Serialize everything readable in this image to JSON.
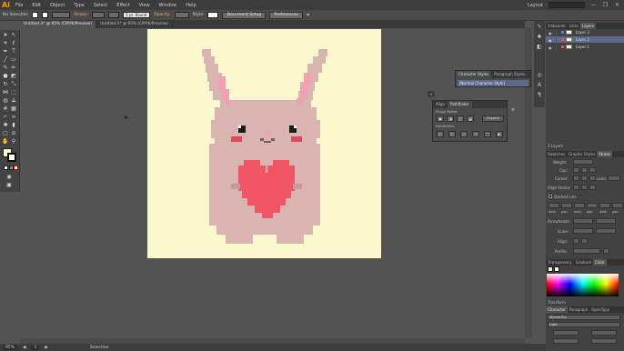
{
  "menubar": {
    "logo": "Ai",
    "items": [
      "File",
      "Edit",
      "Object",
      "Type",
      "Select",
      "Effect",
      "View",
      "Window",
      "Help"
    ],
    "workspace": "Layout",
    "controls": [
      "—",
      "❐",
      "✕"
    ]
  },
  "controlbar": {
    "selection_label": "No Selection",
    "stroke_label": "Stroke:",
    "brush_label": "5 pt. Round",
    "opacity_label": "Opacity:",
    "style_label": "Style:",
    "doc_setup_label": "Document Setup",
    "preferences_label": "Preferences"
  },
  "tabs": [
    {
      "label": "Untitled-1* @ 95% (CMYK/Preview)",
      "active": false
    },
    {
      "label": "Untitled-3* @ 95% (CMYK/Preview)",
      "active": true
    }
  ],
  "tool_icons": [
    "selection-icon",
    "direct-selection-icon",
    "magic-wand-icon",
    "lasso-icon",
    "pen-icon",
    "type-icon",
    "line-icon",
    "rectangle-icon",
    "paintbrush-icon",
    "pencil-icon",
    "blob-brush-icon",
    "eraser-icon",
    "rotate-icon",
    "scale-icon",
    "width-icon",
    "free-transform-icon",
    "shape-builder-icon",
    "perspective-icon",
    "mesh-icon",
    "gradient-icon",
    "eyedropper-icon",
    "blend-icon",
    "symbol-sprayer-icon",
    "graph-icon",
    "artboard-icon",
    "slice-icon",
    "hand-icon",
    "zoom-icon"
  ],
  "layers_panel": {
    "tabs": [
      "Artboards",
      "Links",
      "Layers"
    ],
    "layers": [
      {
        "name": "Layer 3",
        "color": "#4f81ff",
        "selected": false
      },
      {
        "name": "Layer 2",
        "color": "#ff4f4f",
        "selected": true
      },
      {
        "name": "Layer 1",
        "color": "#ff4f4f",
        "selected": false
      }
    ],
    "count": "3 Layers"
  },
  "swatches_panel": {
    "tabs": [
      "Swatches",
      "Graphic Styles",
      "Stroke"
    ],
    "weight_label": "Weight:",
    "cap_label": "Cap:",
    "corner_label": "Corner:",
    "limit_label": "Limit:",
    "align_label": "Align Stroke:",
    "dashed_label": "Dashed Line",
    "dash_labels": [
      "dash",
      "gap",
      "dash",
      "gap",
      "dash",
      "gap"
    ],
    "arrowheads_label": "Arrowheads:",
    "scale_label": "Scale:",
    "align2_label": "Align:",
    "profile_label": "Profile:"
  },
  "color_panel": {
    "tabs": [
      "Transparency",
      "Gradient",
      "Color"
    ]
  },
  "bottom_panels": {
    "transform_label": "Transform",
    "character_tabs": [
      "Character",
      "Paragraph",
      "OpenType"
    ],
    "font_name": "Myriad Pro",
    "font_style": "Light"
  },
  "char_styles_panel": {
    "tabs": [
      "Character Styles",
      "Paragraph Styles"
    ],
    "item": "[Normal Character Style]"
  },
  "pathfinder_panel": {
    "tabs": [
      "Align",
      "Pathfinder"
    ],
    "shape_modes_label": "Shape Modes:",
    "expand_label": "Expand",
    "pathfinders_label": "Pathfinders:"
  },
  "status": {
    "zoom": "95%",
    "page": "1",
    "tool": "Selection"
  },
  "colors": {
    "artboard": "#fcf8cd",
    "rabbit_body": "#d9b4b0",
    "rabbit_ear_inner": "#f2a0b4",
    "heart": "#f05566",
    "cheek": "#e04a5e",
    "eye": "#1a1a1a"
  }
}
